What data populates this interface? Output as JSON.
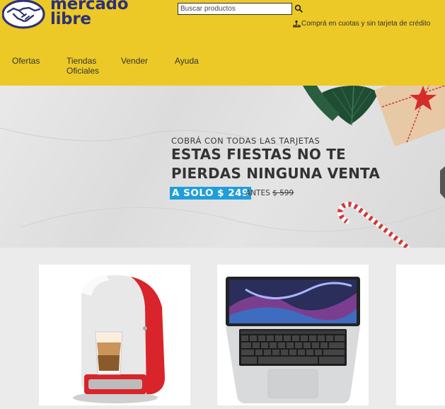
{
  "header": {
    "logo_text_line1": "mercado",
    "logo_text_line2": "libre",
    "search_placeholder": "Buscar productos",
    "promo_text": "Comprá en cuotas y sin tarjeta de crédito"
  },
  "nav": [
    {
      "label": "Ofertas"
    },
    {
      "label": "Tiendas Oficiales"
    },
    {
      "label": "Vender"
    },
    {
      "label": "Ayuda"
    }
  ],
  "hero": {
    "subtitle": "COBRÁ CON TODAS LAS TARJETAS",
    "title": "ESTAS FIESTAS NO TE PIERDAS NINGUNA VENTA",
    "price_label": "A SOLO $ 249",
    "old_price_prefix": "ANTES",
    "old_price": "$ 599"
  },
  "products": [
    {
      "name": "coffee-machine",
      "icon": "coffee-maker-image"
    },
    {
      "name": "laptop",
      "icon": "macbook-image"
    },
    {
      "name": "partial-card",
      "icon": ""
    }
  ],
  "colors": {
    "header_bg": "#ecc926",
    "logo_blue": "#2d3277",
    "price_badge": "#1f9edb",
    "page_bg": "#ebebeb"
  }
}
